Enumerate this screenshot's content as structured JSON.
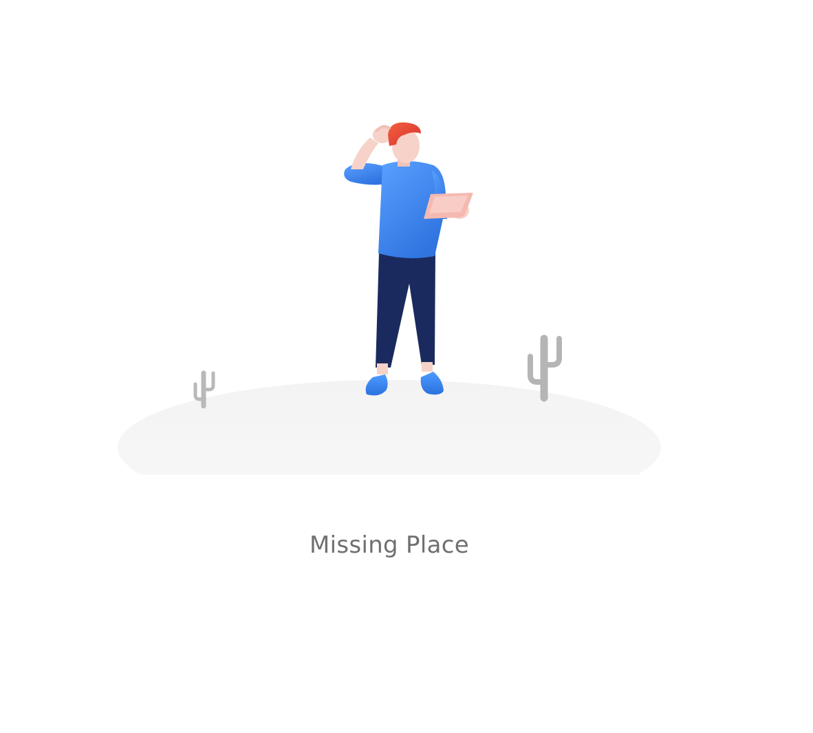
{
  "empty_state": {
    "title": "Missing Place",
    "illustration": {
      "subject": "confused-person-icon",
      "props": [
        "tablet-icon",
        "cactus-icon",
        "hill-icon"
      ]
    }
  },
  "colors": {
    "background": "#ffffff",
    "title_text": "#6f6f6f",
    "hair": "#e8413a",
    "skin": "#f6d2c8",
    "shirt": "#3f8cf0",
    "pants": "#1a2a5c",
    "shoes": "#3a86ee",
    "tablet": "#f4b8b0",
    "cactus": "#b8b8b8",
    "hill": "#f2f2f2"
  }
}
